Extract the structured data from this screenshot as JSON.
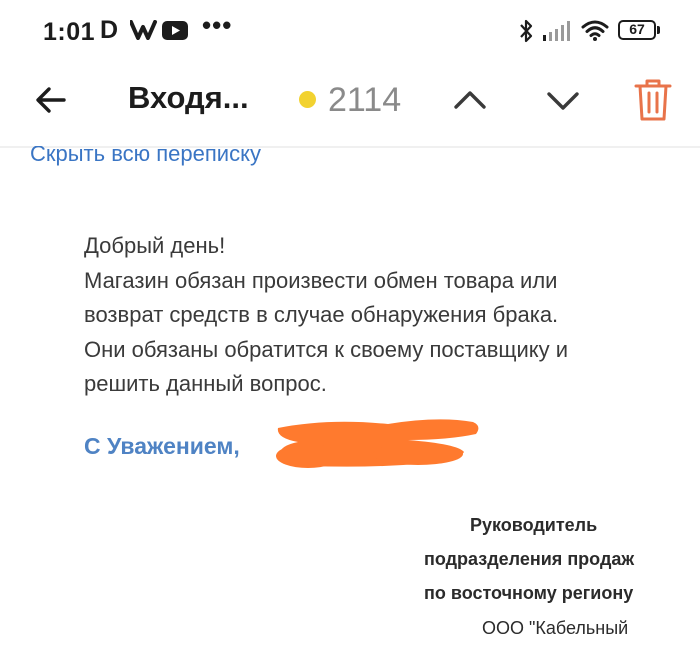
{
  "status_bar": {
    "time": "1:01",
    "app_icons": [
      "d-icon",
      "w-icon",
      "youtube-icon"
    ],
    "more": "•••",
    "battery_level": "67",
    "right_icons": [
      "bluetooth-icon",
      "signal-icon",
      "wifi-icon",
      "battery-icon"
    ]
  },
  "toolbar": {
    "back_icon": "arrow-left-icon",
    "title": "Входя...",
    "unread_dot_color": "#f2d230",
    "unread_count": "2114",
    "prev_icon": "chevron-up-icon",
    "next_icon": "chevron-down-icon",
    "delete_icon": "trash-icon",
    "delete_color": "#e8734a"
  },
  "message": {
    "hide_thread_link": "Скрыть всю переписку",
    "body_lines": [
      "Добрый день!",
      "Магазин обязан произвести обмен товара или",
      "возврат средств в случае обнаружения брака.",
      "Они обязаны обратится к своему поставщику и",
      "решить данный вопрос."
    ],
    "regards": "С Уважением,",
    "redaction_color": "#ff7a2e",
    "signature": [
      "Руководитель",
      "подразделения продаж",
      "по восточному региону",
      "ООО \"Кабельный"
    ]
  }
}
